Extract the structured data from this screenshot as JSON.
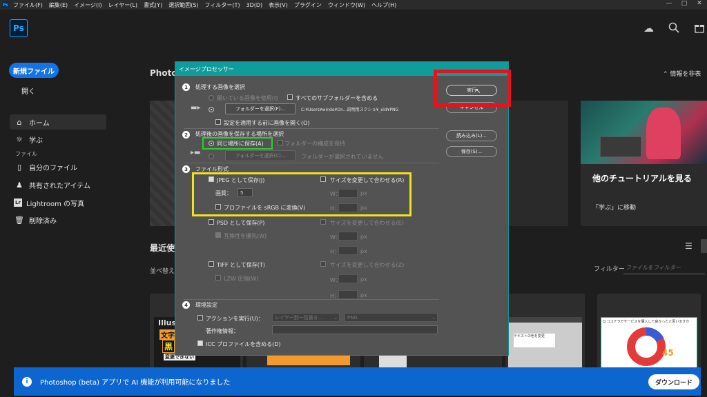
{
  "menubar": {
    "app_icon": "Ps",
    "items": [
      "ファイル(F)",
      "編集(E)",
      "イメージ(I)",
      "レイヤー(L)",
      "書式(Y)",
      "選択範囲(S)",
      "フィルター(T)",
      "3D(D)",
      "表示(V)",
      "プラグイン",
      "ウィンドウ(W)",
      "ヘルプ(H)"
    ],
    "window_controls": [
      "—",
      "□",
      "✕"
    ]
  },
  "header": {
    "logo": "Ps",
    "icons": [
      "cloud-icon",
      "search-icon",
      "gift-icon"
    ]
  },
  "sidebar": {
    "new_file": "新規ファイル",
    "open": "開く",
    "items": [
      {
        "icon": "⌂",
        "label": "ホーム"
      },
      {
        "icon": "☼",
        "label": "学ぶ"
      }
    ],
    "files_header": "ファイル",
    "file_items": [
      {
        "icon": "▯",
        "label": "自分のファイル"
      },
      {
        "icon": "♟",
        "label": "共有されたアイテム"
      },
      {
        "icon": "Lr",
        "label": "Lightroom の写真"
      },
      {
        "icon": "🗑",
        "label": "削除済み"
      }
    ]
  },
  "main": {
    "photos_heading": "Photos",
    "info_toggle": "情報を非表",
    "tutorial_title": "他のチュートリアルを見る",
    "tutorial_link": "「学ぶ」に移動",
    "recent_heading": "最近使",
    "sort_label": "並べ替え",
    "filter_label": "フィルター",
    "filter_placeholder": "ファイルをフィルター",
    "thumb1_text": [
      "Illust",
      "文字",
      "黒",
      "変更できない"
    ],
    "thumb6_text": "Q.ココナラでサービスを購入して良かったと思いますか",
    "thumb6_value": "45"
  },
  "banner": {
    "message": "Photoshop (beta) アプリで AI 機能が利用可能になりました",
    "download": "ダウンロード"
  },
  "dialog": {
    "title": "イメージプロセッサー",
    "s1": {
      "num": "1",
      "title": "処理する画像を選択",
      "use_open": "開いている画像を使用(I)",
      "include_sub": "すべてのサブフォルダーを含める",
      "select_folder": "フォルダーを選択(F)...",
      "path": "C:¥Users¥winde¥On...説明用スクショ¥_old¥PNG",
      "open_first": "設定を適用する前に画像を開く(O)"
    },
    "s2": {
      "num": "2",
      "title": "処理後の画像を保存する場所を選択",
      "same_location": "同じ場所に保存(A)",
      "keep_structure": "フォルダーの構成を保持",
      "select_folder": "フォルダーを選択(C)...",
      "no_folder": "フォルダーが選択されていません"
    },
    "s3": {
      "num": "3",
      "title": "ファイル形式",
      "jpeg": "JPEG として保存(J)",
      "resize_r": "サイズを変更して合わせる(R)",
      "quality_label": "画質：",
      "quality_value": "5",
      "w": "W：",
      "h": "H：",
      "px": "px",
      "srgb": "プロファイルを sRGB に変換(V)",
      "psd": "PSD として保存(P)",
      "resize_e": "サイズを変更して合わせる(E)",
      "compat": "互換性を優先(W)",
      "tiff": "TIFF として保存(T)",
      "resize_z": "サイズを変更して合わせる(Z)",
      "lzw": "LZW 圧縮(W)"
    },
    "s4": {
      "num": "4",
      "title": "環境設定",
      "run_action": "アクションを実行(U)：",
      "action_set": "レイヤー別一括書き...",
      "action_name": "PNG",
      "copyright_label": "著作権情報：",
      "icc": "ICC プロファイルを含める(D)"
    },
    "buttons": {
      "run": "実行",
      "cancel": "キャンセル",
      "load": "読み込み(L)...",
      "save": "保存(S)..."
    }
  }
}
